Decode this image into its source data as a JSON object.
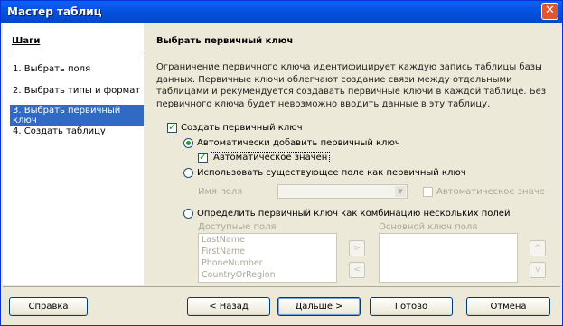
{
  "window": {
    "title": "Мастер таблиц",
    "close_symbol": "✕"
  },
  "steps": {
    "heading": "Шаги",
    "items": [
      {
        "label": "1.  Выбрать поля"
      },
      {
        "label": "2.  Выбрать типы и формат"
      },
      {
        "label": "3.  Выбрать первичный ключ"
      },
      {
        "label": "4.  Создать таблицу"
      }
    ],
    "active_index": 2
  },
  "page": {
    "title": "Выбрать первичный ключ",
    "description": "Ограничение первичного ключа идентифицирует каждую запись таблицы базы данных. Первичные ключи облегчают создание связи между отдельными таблицами и рекумендуется создавать первичные ключи в каждой таблице. Без первичного ключа будет невозможно вводить данные в эту таблицу."
  },
  "options": {
    "create_pk": {
      "label": "Создать первичный ключ",
      "checked": true
    },
    "auto_add": {
      "label": "Автоматически добавить первичный ключ",
      "selected": true
    },
    "auto_value": {
      "label": "Автоматическое значен",
      "checked": true
    },
    "use_existing": {
      "label": "Использовать существующее поле как первичный ключ",
      "selected": false
    },
    "field_name_label": "Имя поля",
    "auto_value_disabled": "Автоматическое значе",
    "combine": {
      "label": "Определить первичный ключ как комбинацию нескольких полей",
      "selected": false
    },
    "available_fields_label": "Доступные поля",
    "pk_fields_label": "Основной ключ поля",
    "available_fields": [
      "LastName",
      "FirstName",
      "PhoneNumber",
      "CountryOrRegion"
    ]
  },
  "buttons": {
    "help": "Справка",
    "back": "< Назад",
    "next": "Дальше >",
    "finish": "Готово",
    "cancel": "Отмена",
    "move_right": ">",
    "move_left": "<",
    "move_up": "^",
    "move_down": "v"
  },
  "colors": {
    "title_bar": "#0553e2",
    "selection": "#316ac5",
    "check": "#21a121"
  }
}
